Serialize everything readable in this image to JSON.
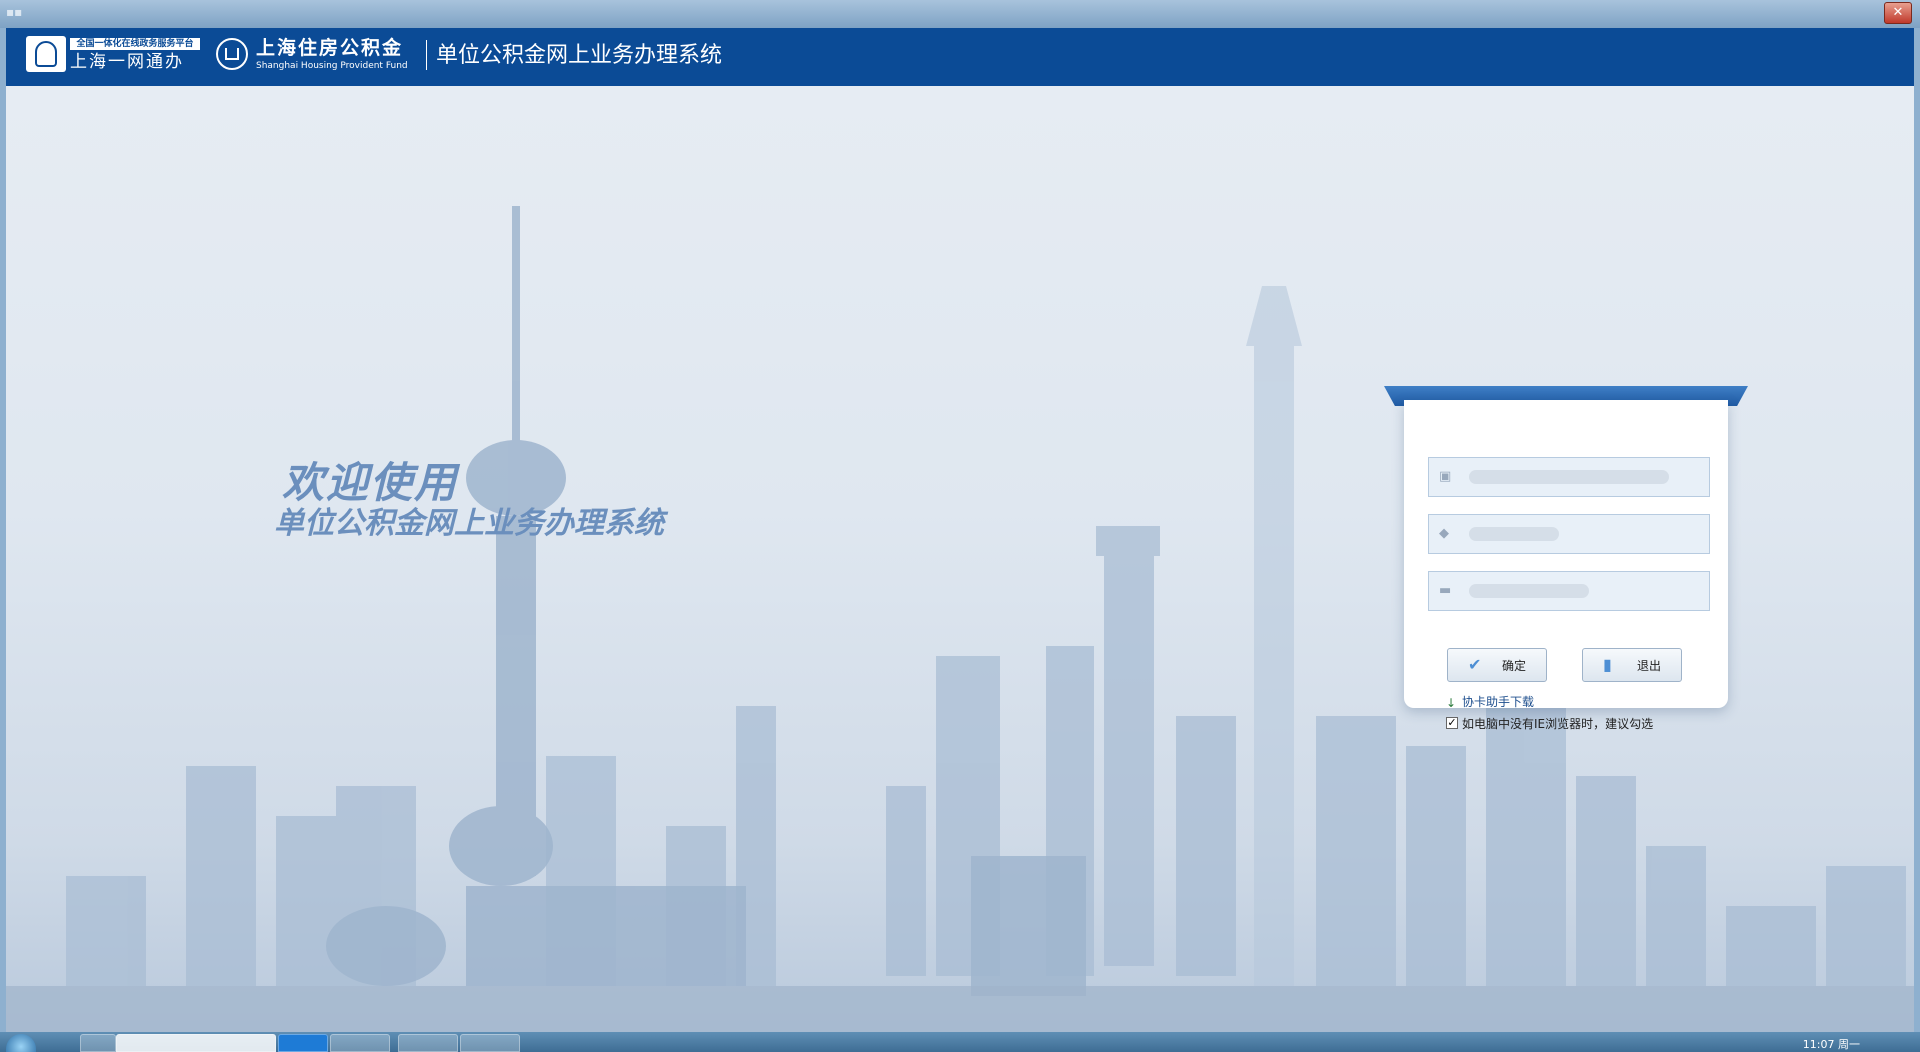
{
  "window": {
    "close_label": "✕"
  },
  "header": {
    "yiwang_small": "全国一体化在线政务服务平台",
    "yiwang_big": "上海一网通办",
    "gjj_cn": "上海住房公积金",
    "gjj_en": "Shanghai Housing Provident Fund",
    "system_name": "单位公积金网上业务办理系统"
  },
  "hero": {
    "welcome": "欢迎使用",
    "system": "单位公积金网上业务办理系统"
  },
  "login": {
    "field1_icon": "briefcase-icon",
    "field2_icon": "tag-icon",
    "field3_icon": "card-icon",
    "ok_label": "确定",
    "exit_label": "退出",
    "download_link": "协卡助手下载",
    "ie_checkbox_label": "如电脑中没有IE浏览器时，建议勾选",
    "ie_checkbox_checked": true
  },
  "taskbar": {
    "clock": "11:07 周一"
  },
  "colors": {
    "header_bg": "#0b4b96",
    "accent": "#1f5aa3",
    "text_welcome": "#6b8fbd"
  }
}
